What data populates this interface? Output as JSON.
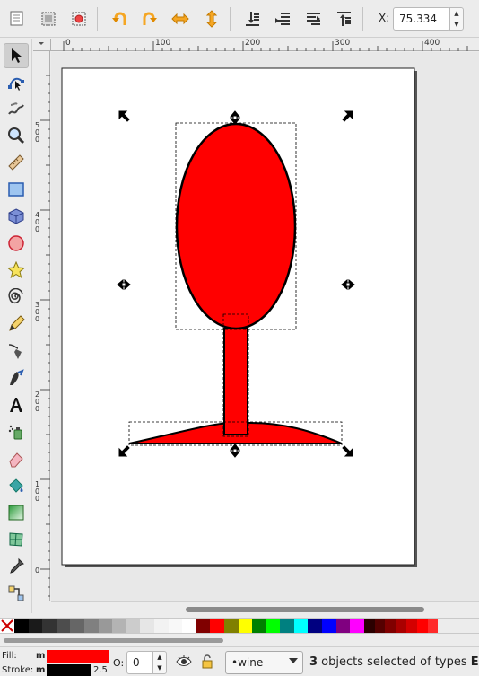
{
  "toolbar": {
    "buttons": [
      "select-all-icon",
      "select-all-layers-icon",
      "touch-select-icon",
      "rotate-ccw-icon",
      "rotate-cw-icon",
      "flip-horizontal-icon",
      "flip-vertical-icon",
      "lower-to-bottom-icon",
      "lower-icon",
      "raise-icon",
      "raise-to-top-icon"
    ],
    "x_label": "X:",
    "x_value": "75.334",
    "spin_up": "▲",
    "spin_down": "▼"
  },
  "tools": [
    "selector-tool-icon",
    "node-tool-icon",
    "tweak-tool-icon",
    "zoom-tool-icon",
    "measure-tool-icon",
    "rectangle-tool-icon",
    "box3d-tool-icon",
    "ellipse-tool-icon",
    "star-tool-icon",
    "spiral-tool-icon",
    "pencil-tool-icon",
    "pen-tool-icon",
    "calligraphy-tool-icon",
    "text-tool-icon",
    "spray-tool-icon",
    "eraser-tool-icon",
    "paint-bucket-tool-icon",
    "gradient-tool-icon",
    "mesh-tool-icon",
    "dropper-tool-icon",
    "connector-tool-icon"
  ],
  "ruler": {
    "h_labels": [
      "0",
      "100",
      "200",
      "300",
      "400"
    ],
    "v_labels": [
      "5\n0\n0",
      "4\n0\n0",
      "3\n0\n0",
      "2\n0\n0",
      "1\n0\n0",
      "0"
    ]
  },
  "palette": [
    "#000000",
    "#1a1a1a",
    "#333333",
    "#4d4d4d",
    "#666666",
    "#808080",
    "#999999",
    "#b3b3b3",
    "#cccccc",
    "#e6e6e6",
    "#f2f2f2",
    "#f8f8f8",
    "#ffffff",
    "#800000",
    "#ff0000",
    "#808000",
    "#ffff00",
    "#008000",
    "#00ff00",
    "#008080",
    "#00ffff",
    "#000080",
    "#0000ff",
    "#800080",
    "#ff00ff",
    "#2b0000",
    "#550000",
    "#800000",
    "#aa0000",
    "#d40000",
    "#ff0000",
    "#ff2a2a"
  ],
  "colors": {
    "fill": "#ff0000",
    "stroke": "#000000",
    "accent": "#ff0000"
  },
  "status": {
    "fill_label": "Fill:",
    "stroke_label": "Stroke:",
    "fill_flag": "m",
    "stroke_flag": "m",
    "stroke_width": "2.5",
    "opacity_label": "O:",
    "opacity_value": "0",
    "layer_name": "•wine",
    "message_count": "3",
    "message_mid": " objects selected of types ",
    "message_types": "Ell"
  }
}
